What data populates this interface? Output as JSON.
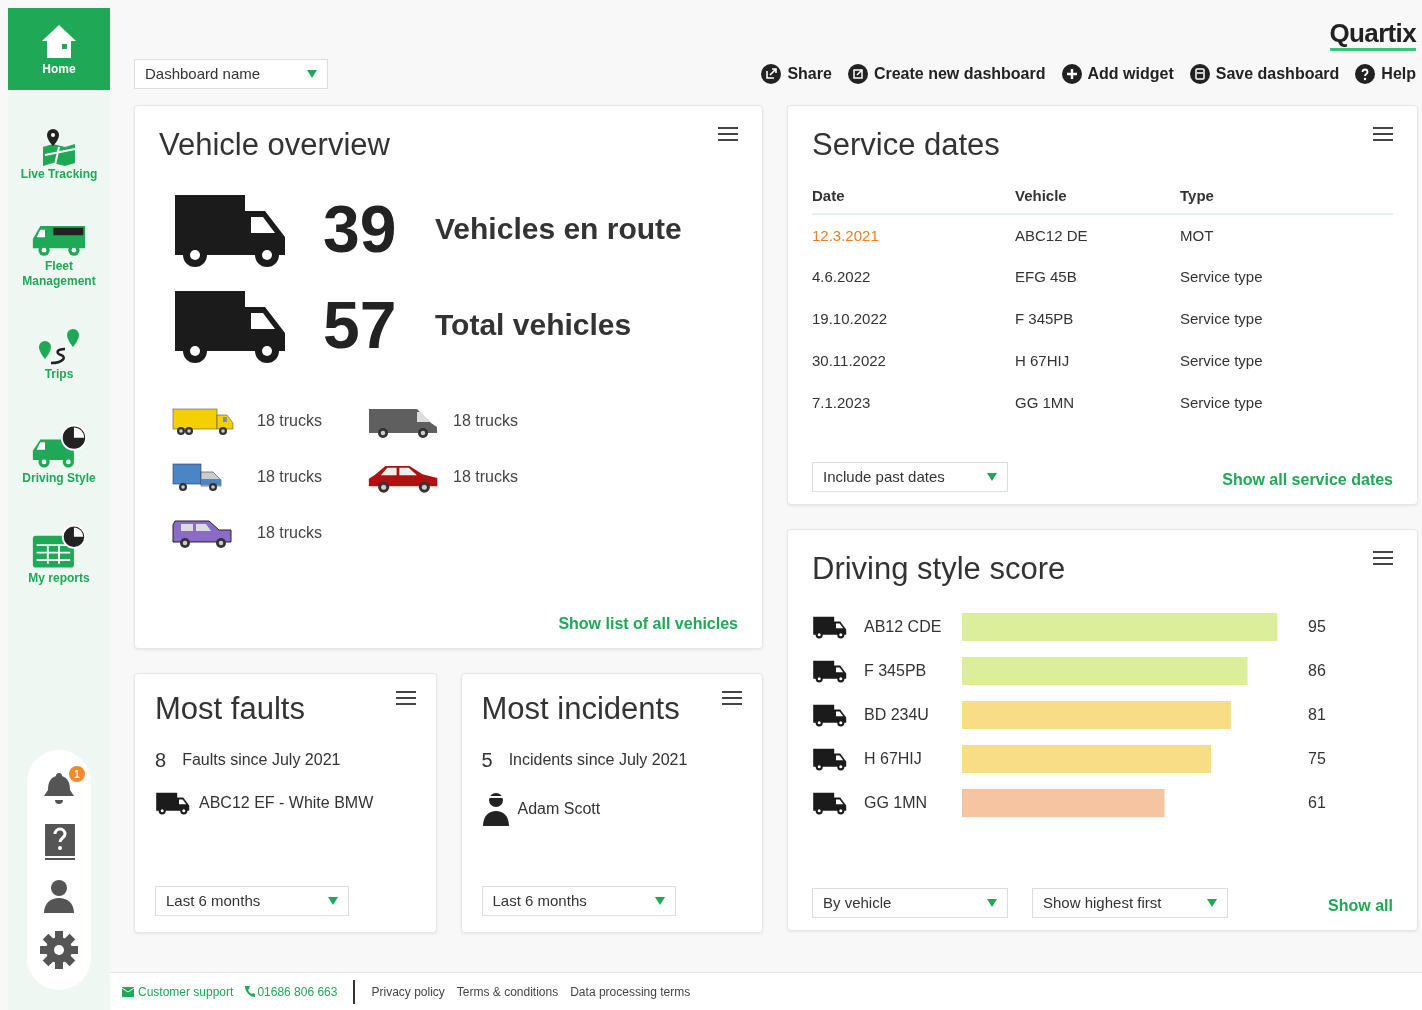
{
  "sidebar": {
    "items": [
      {
        "label": "Home",
        "kind": "home",
        "selected": true
      },
      {
        "label": "Live Tracking",
        "kind": "map",
        "selected": false
      },
      {
        "label": "Fleet Management",
        "kind": "truck",
        "selected": false
      },
      {
        "label": "Trips",
        "kind": "trips",
        "selected": false
      },
      {
        "label": "Driving Style",
        "kind": "truck-chart",
        "selected": false
      },
      {
        "label": "My reports",
        "kind": "report-chart",
        "selected": false
      }
    ],
    "notification_count": "1"
  },
  "header": {
    "logo": "Quartix",
    "dashboard_select": "Dashboard name",
    "actions": [
      {
        "label": "Share",
        "kind": "share"
      },
      {
        "label": "Create new dashboard",
        "kind": "create"
      },
      {
        "label": "Add widget",
        "kind": "add"
      },
      {
        "label": "Save dashboard",
        "kind": "save"
      },
      {
        "label": "Help",
        "kind": "help"
      }
    ]
  },
  "vehicle_overview": {
    "title": "Vehicle overview",
    "stats": [
      {
        "value": "39",
        "label": "Vehicles en route"
      },
      {
        "value": "57",
        "label": "Total vehicles"
      }
    ],
    "types": [
      {
        "kind": "box-truck",
        "color": "#f5d000",
        "label": "18 trucks"
      },
      {
        "kind": "van",
        "color": "#5f5f5f",
        "label": "18 trucks"
      },
      {
        "kind": "small-truck",
        "color": "#4a86c5",
        "label": "18 trucks"
      },
      {
        "kind": "suv",
        "color": "#b01010",
        "label": "18 trucks"
      },
      {
        "kind": "jeep",
        "color": "#8a6cc8",
        "label": "18 trucks"
      }
    ],
    "link": "Show list of all vehicles"
  },
  "service_dates": {
    "title": "Service dates",
    "columns": [
      "Date",
      "Vehicle",
      "Type"
    ],
    "rows": [
      {
        "date": "12.3.2021",
        "vehicle": "ABC12 DE",
        "type": "MOT",
        "overdue": true
      },
      {
        "date": "4.6.2022",
        "vehicle": "EFG 45B",
        "type": "Service type",
        "overdue": false
      },
      {
        "date": "19.10.2022",
        "vehicle": "F 345PB",
        "type": "Service type",
        "overdue": false
      },
      {
        "date": "30.11.2022",
        "vehicle": "H 67HIJ",
        "type": "Service type",
        "overdue": false
      },
      {
        "date": "7.1.2023",
        "vehicle": "GG 1MN",
        "type": "Service type",
        "overdue": false
      }
    ],
    "filter": "Include past dates",
    "link": "Show all service dates"
  },
  "driving_style": {
    "title": "Driving style score",
    "chart_data": {
      "type": "bar",
      "orientation": "horizontal",
      "categories": [
        "AB12 CDE",
        "F 345PB",
        "BD 234U",
        "H 67HIJ",
        "GG 1MN"
      ],
      "series": [
        {
          "values": [
            95,
            86,
            81,
            75,
            61
          ]
        }
      ],
      "data_labels": true
    },
    "group_select": "By vehicle",
    "order_select": "Show highest first",
    "link": "Show all"
  },
  "most_faults": {
    "title": "Most faults",
    "count": "8",
    "summary": "Faults since July 2021",
    "item": "ABC12 EF - White BMW",
    "period": "Last 6 months"
  },
  "most_incidents": {
    "title": "Most incidents",
    "count": "5",
    "summary": "Incidents since July 2021",
    "item": "Adam Scott",
    "period": "Last 6 months"
  },
  "footer": {
    "support": "Customer support",
    "phone": "01686 806 663",
    "links": [
      "Privacy policy",
      "Terms & conditions",
      "Data processing terms"
    ]
  }
}
